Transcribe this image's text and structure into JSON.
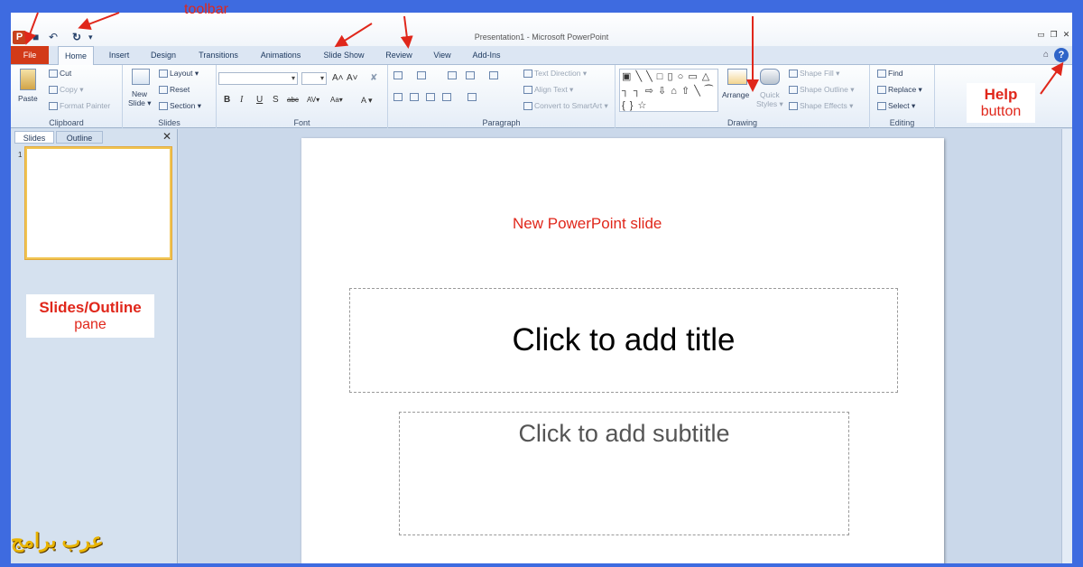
{
  "window": {
    "title": "Presentation1 - Microsoft PowerPoint",
    "app_icon_letter": "P",
    "qat_save": "■",
    "qat_undo": "↶",
    "qat_redo": "↻",
    "qat_more": "▾",
    "min": "▭",
    "restore": "❐",
    "close": "✕"
  },
  "tabs": {
    "file": "File",
    "items": [
      "Home",
      "Insert",
      "Design",
      "Transitions",
      "Animations",
      "Slide Show",
      "Review",
      "View",
      "Add-Ins"
    ],
    "ribbon_minimize": "⌂",
    "help": "?"
  },
  "ribbon": {
    "clipboard": {
      "label": "Clipboard",
      "paste": "Paste",
      "cut": "Cut",
      "copy": "Copy ▾",
      "format_painter": "Format Painter"
    },
    "slides": {
      "label": "Slides",
      "new_slide_1": "New",
      "new_slide_2": "Slide ▾",
      "layout": "Layout ▾",
      "reset": "Reset",
      "section": "Section ▾"
    },
    "font": {
      "label": "Font",
      "bold": "B",
      "italic": "I",
      "underline": "U",
      "strike": "S",
      "shadow": "abc",
      "spacing": "AV▾",
      "case": "Aa▾",
      "color": "A ▾",
      "grow": "A˄",
      "shrink": "A˅",
      "clear": "✘"
    },
    "paragraph": {
      "label": "Paragraph",
      "text_direction": "Text Direction ▾",
      "align_text": "Align Text ▾",
      "smartart": "Convert to SmartArt ▾"
    },
    "drawing": {
      "label": "Drawing",
      "shapes": "▣ ╲ ╲ □ ▯ ○ ▭ △ ┐ ┐ ⇨ ⇩ ⌂ ⇧ ╲ ⁀ { } ☆",
      "arrange": "Arrange",
      "quick_styles_1": "Quick",
      "quick_styles_2": "Styles ▾",
      "shape_fill": "Shape Fill ▾",
      "shape_outline": "Shape Outline ▾",
      "shape_effects": "Shape Effects ▾"
    },
    "editing": {
      "label": "Editing",
      "find": "Find",
      "replace": "Replace ▾",
      "select": "Select ▾"
    }
  },
  "pane": {
    "tab_slides": "Slides",
    "tab_outline": "Outline",
    "close": "✕",
    "thumb_number": "1"
  },
  "slide": {
    "title_placeholder": "Click to add title",
    "subtitle_placeholder": "Click to add subtitle"
  },
  "annotations": {
    "toolbar": "toolbar",
    "help_1": "Help",
    "help_2": "button",
    "pane_1": "Slides/Outline",
    "pane_2": "pane",
    "new_slide": "New PowerPoint slide",
    "watermark": "عرب برامج"
  },
  "colors": {
    "annotation": "#e0271b",
    "file_tab": "#d23a18",
    "border": "#3e6be0"
  }
}
